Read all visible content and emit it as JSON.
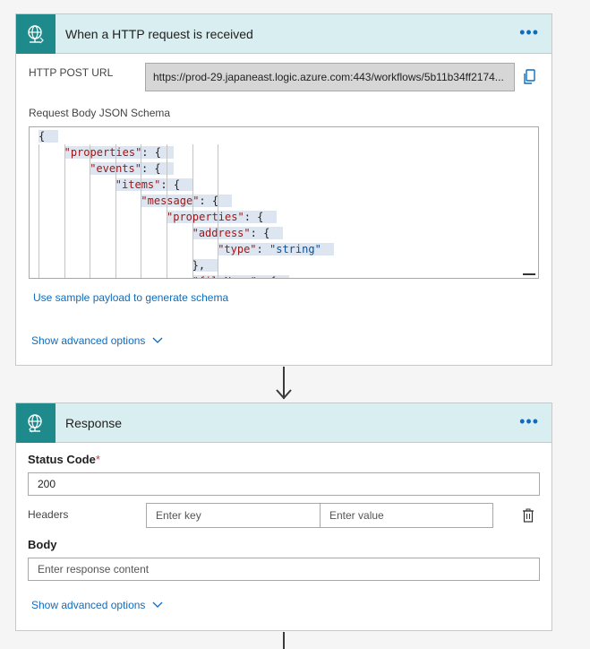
{
  "trigger": {
    "title": "When a HTTP request is received",
    "more": "•••",
    "url_label": "HTTP POST URL",
    "url_value": "https://prod-29.japaneast.logic.azure.com:443/workflows/5b11b34ff2174...",
    "schema_label": "Request Body JSON Schema",
    "schema_lines": [
      {
        "indent": 0,
        "parts": [
          [
            "p",
            "{"
          ]
        ]
      },
      {
        "indent": 1,
        "parts": [
          [
            "k",
            "\"properties\""
          ],
          [
            "p",
            ": {"
          ]
        ]
      },
      {
        "indent": 2,
        "parts": [
          [
            "k",
            "\"events\""
          ],
          [
            "p",
            ": {"
          ]
        ]
      },
      {
        "indent": 3,
        "parts": [
          [
            "k",
            "\"items\""
          ],
          [
            "p",
            ": {"
          ]
        ]
      },
      {
        "indent": 4,
        "parts": [
          [
            "k",
            "\"message\""
          ],
          [
            "p",
            ": {"
          ]
        ]
      },
      {
        "indent": 5,
        "parts": [
          [
            "k",
            "\"properties\""
          ],
          [
            "p",
            ": {"
          ]
        ]
      },
      {
        "indent": 6,
        "parts": [
          [
            "k",
            "\"address\""
          ],
          [
            "p",
            ": {"
          ]
        ]
      },
      {
        "indent": 7,
        "parts": [
          [
            "k",
            "\"type\""
          ],
          [
            "p",
            ": "
          ],
          [
            "s",
            "\"string\""
          ]
        ]
      },
      {
        "indent": 6,
        "parts": [
          [
            "p",
            "},"
          ]
        ]
      },
      {
        "indent": 6,
        "parts": [
          [
            "k",
            "\"fileName\""
          ],
          [
            "p",
            ": {"
          ]
        ]
      }
    ],
    "sample_link": "Use sample payload to generate schema",
    "advanced": "Show advanced options"
  },
  "response": {
    "title": "Response",
    "more": "•••",
    "status_label": "Status Code",
    "required_mark": "*",
    "status_value": "200",
    "headers_label": "Headers",
    "key_placeholder": "Enter key",
    "value_placeholder": "Enter value",
    "body_label": "Body",
    "body_placeholder": "Enter response content",
    "advanced": "Show advanced options"
  },
  "colors": {
    "accent": "#1f8a8c",
    "header_bg": "#d8eef0",
    "link": "#0f6cbd",
    "required": "#d13438"
  },
  "icons": {
    "trigger": "http-request-globe-icon",
    "response": "http-response-globe-icon",
    "copy": "copy-icon",
    "delete": "delete-icon",
    "more": "more-options-icon",
    "chevron": "chevron-down-icon"
  }
}
